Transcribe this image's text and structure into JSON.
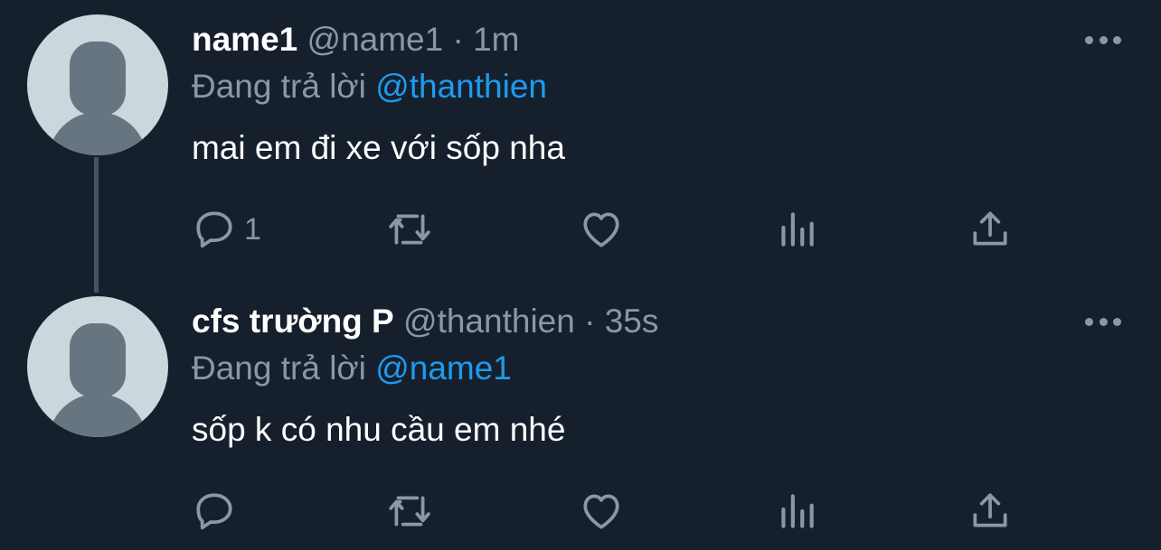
{
  "tweets": [
    {
      "display_name": "name1",
      "handle": "@name1",
      "separator": "·",
      "time": "1m",
      "reply_prefix": "Đang trả lời",
      "reply_to": "@thanthien",
      "text": "mai em đi xe với sốp nha",
      "reply_count": "1",
      "icons": [
        "reply-icon",
        "retweet-icon",
        "like-icon",
        "stats-icon",
        "share-icon",
        "more-icon"
      ]
    },
    {
      "display_name": "cfs trường P",
      "handle": "@thanthien",
      "separator": "·",
      "time": "35s",
      "reply_prefix": "Đang trả lời",
      "reply_to": "@name1",
      "text": "sốp k có nhu cầu em nhé",
      "reply_count": "",
      "icons": [
        "reply-icon",
        "retweet-icon",
        "like-icon",
        "stats-icon",
        "share-icon",
        "more-icon"
      ]
    }
  ],
  "colors": {
    "background": "#16202c",
    "text": "#ffffff",
    "muted": "#8899a6",
    "mention": "#1d9bf0",
    "thread_line": "#425463"
  }
}
